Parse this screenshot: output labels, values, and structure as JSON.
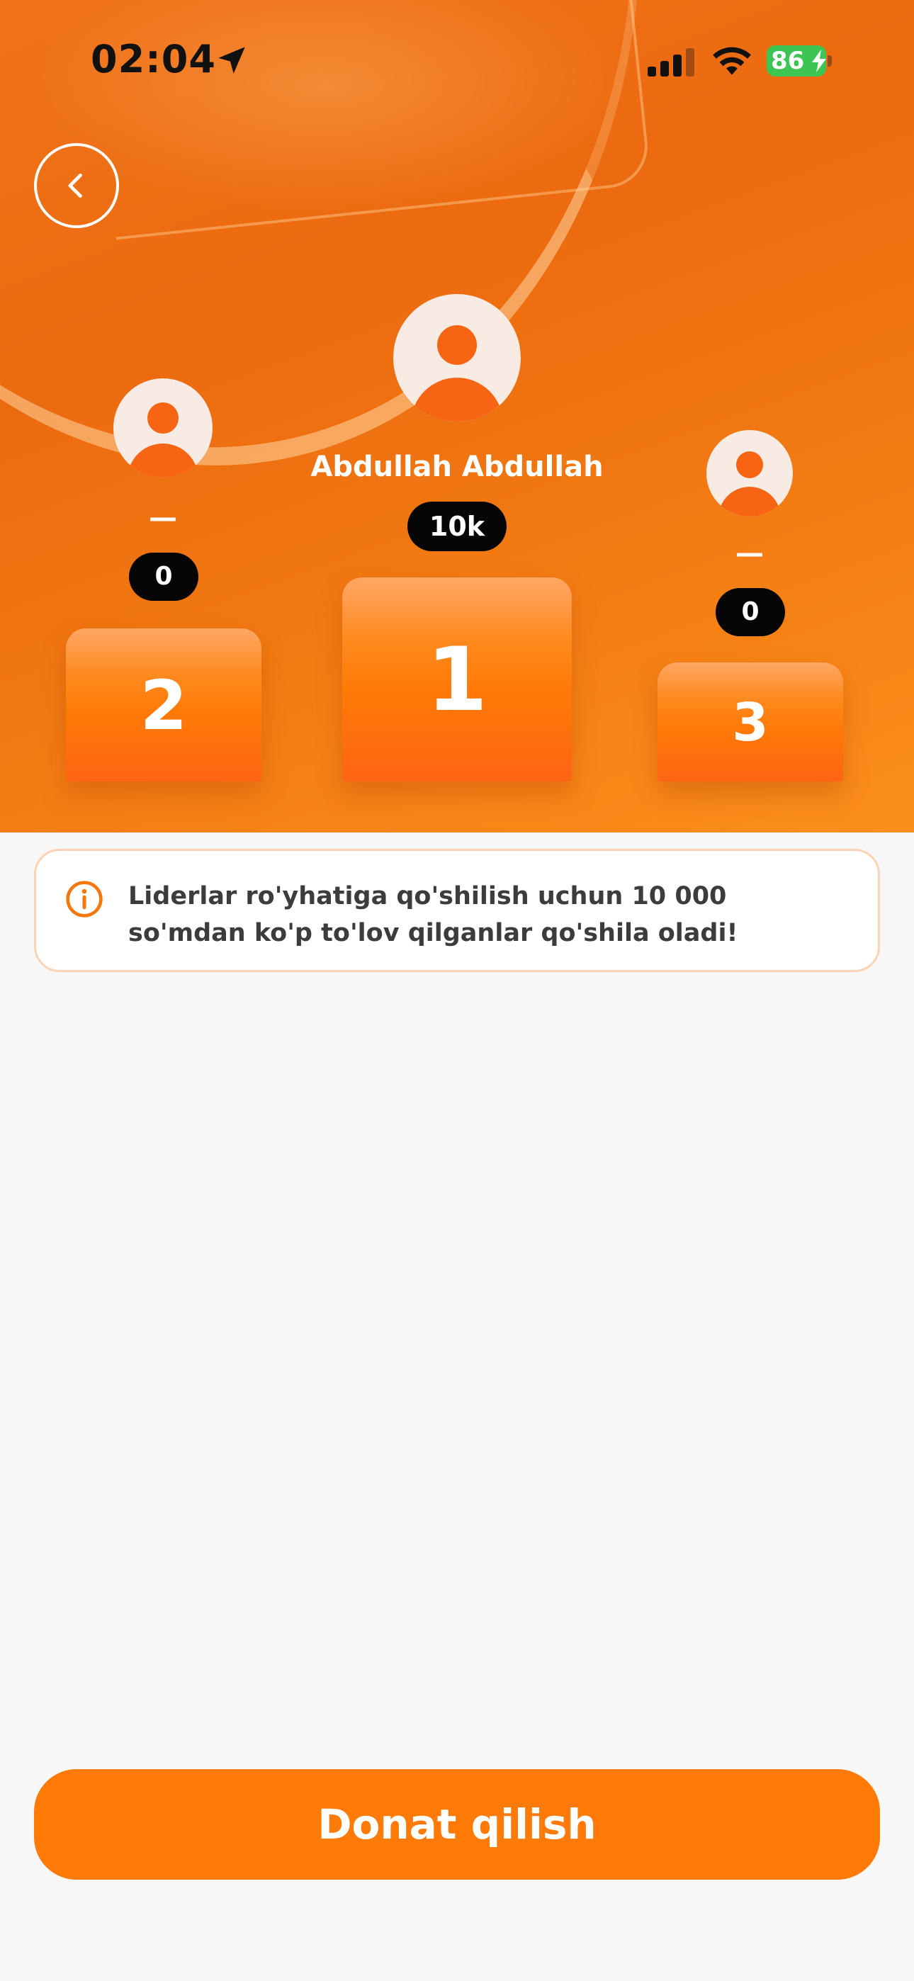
{
  "status_bar": {
    "time": "02:04",
    "battery_level": "86",
    "battery_charging": true,
    "icons": [
      "location-arrow-icon",
      "cellular-signal-icon",
      "wifi-icon",
      "battery-charging-icon"
    ]
  },
  "header": {
    "back_icon": "chevron-left-icon"
  },
  "podium": [
    {
      "rank": "1",
      "name": "Abdullah Abdullah",
      "score": "10k"
    },
    {
      "rank": "2",
      "name": "—",
      "score": "0"
    },
    {
      "rank": "3",
      "name": "—",
      "score": "0"
    }
  ],
  "notice": {
    "icon": "info-circle-icon",
    "text": "Liderlar ro'yhatiga qo'shilish uchun 10 000 so'mdan ko'p to'lov qilganlar qo'shila oladi!"
  },
  "actions": {
    "donate_label": "Donat qilish"
  },
  "colors": {
    "accent": "#ff7a07",
    "avatar_fill": "#f76514",
    "avatar_bg": "#f8ebe3",
    "score_pill": "#050505",
    "battery": "#3cc552",
    "notice_border": "#fcd3b4"
  }
}
